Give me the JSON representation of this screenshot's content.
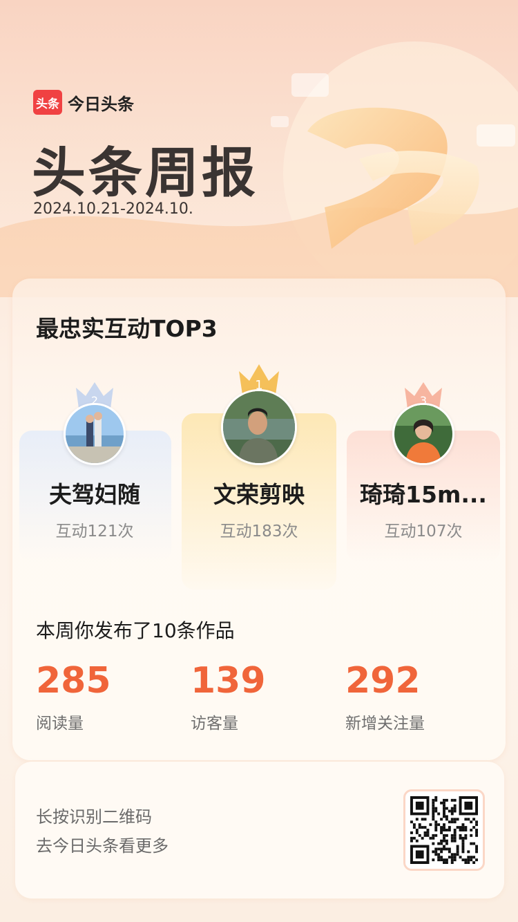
{
  "brand": {
    "mark": "头条",
    "name": "今日头条"
  },
  "hero": {
    "title": "头条周报",
    "date_range": "2024.10.21-2024.10."
  },
  "top3": {
    "title": "最忠实互动TOP3",
    "ranks": [
      {
        "rank": "2",
        "name": "夫驾妇随",
        "count": "互动121次"
      },
      {
        "rank": "1",
        "name": "文荣剪映",
        "count": "互动183次"
      },
      {
        "rank": "3",
        "name": "琦琦15m...",
        "count": "互动107次"
      }
    ]
  },
  "week": {
    "summary": "本周你发布了10条作品",
    "stats": [
      {
        "value": "285",
        "label": "阅读量"
      },
      {
        "value": "139",
        "label": "访客量"
      },
      {
        "value": "292",
        "label": "新增关注量"
      }
    ]
  },
  "footer": {
    "line1": "长按识别二维码",
    "line2": "去今日头条看更多"
  },
  "colors": {
    "accent": "#f0653a",
    "brand": "#f04142",
    "gold": "#f5c05a",
    "silver": "#b8c8e8",
    "bronze": "#f5a08c"
  }
}
